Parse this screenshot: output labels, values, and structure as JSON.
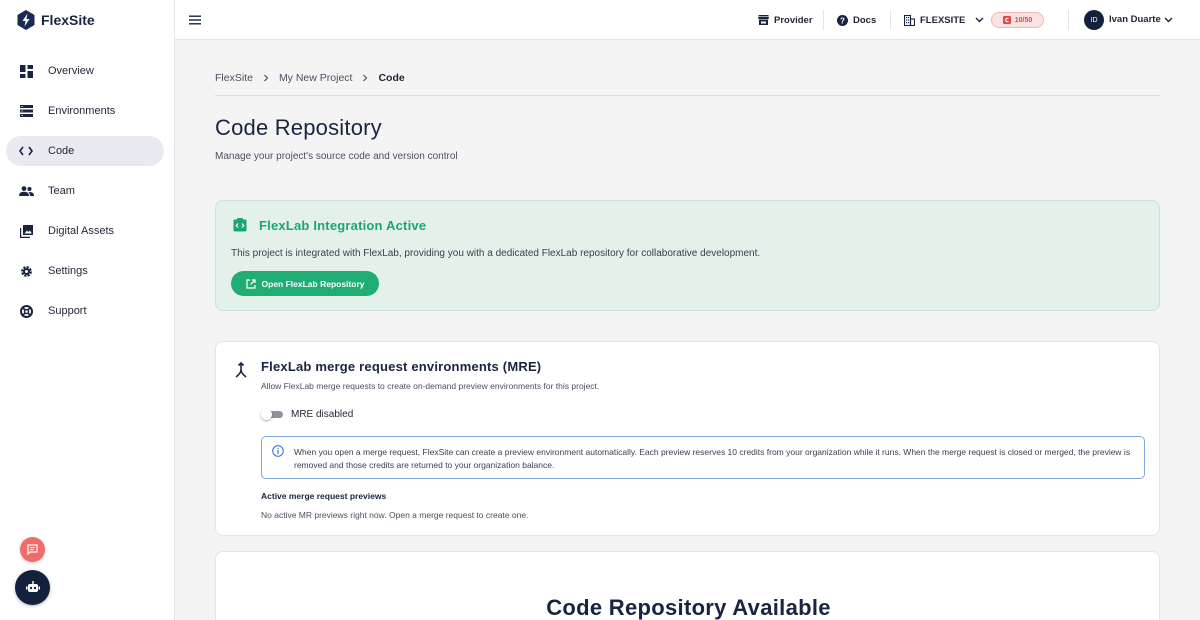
{
  "app": {
    "name": "FlexSite"
  },
  "sidebar": {
    "items": [
      {
        "label": "Overview",
        "icon": "dashboard-icon"
      },
      {
        "label": "Environments",
        "icon": "server-icon"
      },
      {
        "label": "Code",
        "icon": "code-icon",
        "active": true
      },
      {
        "label": "Team",
        "icon": "team-icon"
      },
      {
        "label": "Digital Assets",
        "icon": "image-library-icon"
      },
      {
        "label": "Settings",
        "icon": "gear-icon"
      },
      {
        "label": "Support",
        "icon": "lifebuoy-icon"
      }
    ]
  },
  "topbar": {
    "provider_label": "Provider",
    "docs_label": "Docs",
    "org_label": "FLEXSITE",
    "credits_label": "10/50",
    "user_initials": "ID",
    "user_name": "Ivan Duarte"
  },
  "breadcrumb": [
    "FlexSite",
    "My New Project",
    "Code"
  ],
  "page": {
    "title": "Code Repository",
    "subtitle": "Manage your project's source code and version control"
  },
  "integration": {
    "title": "FlexLab Integration Active",
    "description": "This project is integrated with FlexLab, providing you with a dedicated FlexLab repository for collaborative development.",
    "button_label": "Open FlexLab Repository"
  },
  "mre": {
    "title": "FlexLab merge request environments (MRE)",
    "description": "Allow FlexLab merge requests to create on-demand preview environments for this project.",
    "toggle_label": "MRE disabled",
    "toggle_on": false,
    "info_text": "When you open a merge request, FlexSite can create a preview environment automatically. Each preview reserves 10 credits from your organization while it runs. When the merge request is closed or merged, the preview is removed and those credits are returned to your organization balance.",
    "active_title": "Active merge request previews",
    "active_empty": "No active MR previews right now. Open a merge request to create one."
  },
  "repo": {
    "title": "Code Repository Available"
  },
  "colors": {
    "brand_dark": "#14213d",
    "success": "#1fad74",
    "danger": "#f26b6b"
  }
}
